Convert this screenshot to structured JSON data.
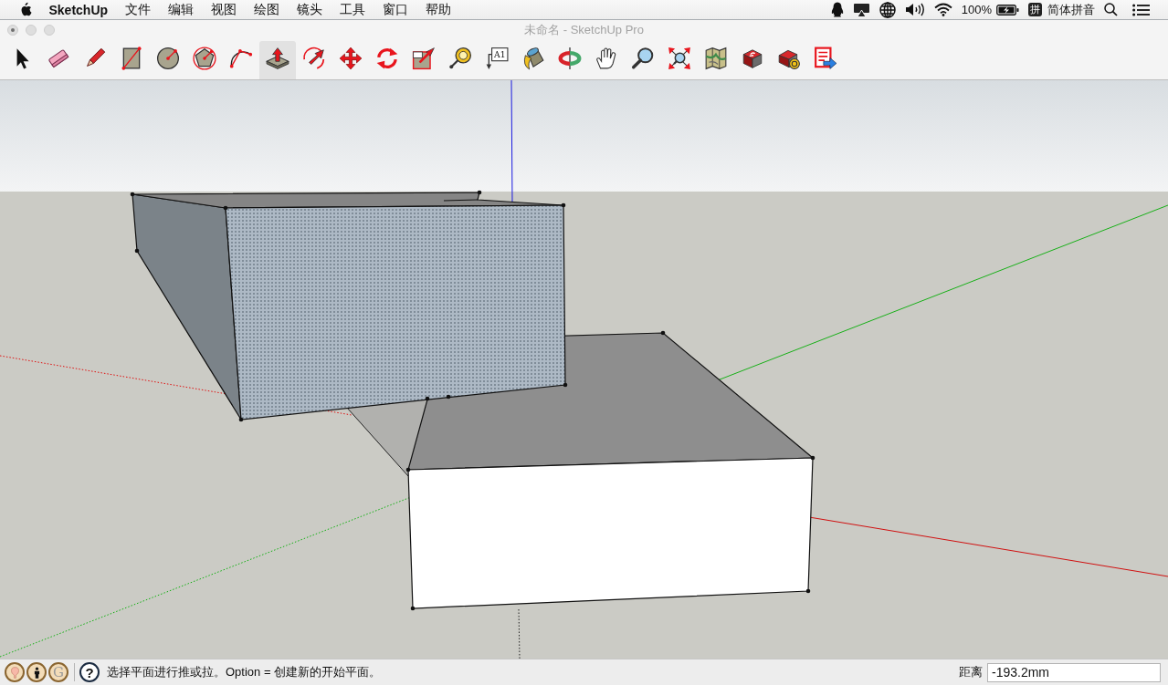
{
  "menu_bar": {
    "app_name": "SketchUp",
    "menus": [
      "文件",
      "编辑",
      "视图",
      "绘图",
      "镜头",
      "工具",
      "窗口",
      "帮助"
    ],
    "battery_percent": "100%",
    "input_method_badge": "拼",
    "input_method": "简体拼音"
  },
  "window": {
    "title": "未命名 - SketchUp Pro"
  },
  "toolbar": {
    "tools": [
      {
        "kind": "select",
        "selected": false
      },
      {
        "kind": "eraser",
        "selected": false
      },
      {
        "kind": "pencil",
        "selected": false
      },
      {
        "kind": "rectangle",
        "selected": false
      },
      {
        "kind": "circle",
        "selected": false
      },
      {
        "kind": "polygon",
        "selected": false
      },
      {
        "kind": "arc",
        "selected": false
      },
      {
        "kind": "pushpull",
        "selected": true
      },
      {
        "kind": "followme",
        "selected": false
      },
      {
        "kind": "move",
        "selected": false
      },
      {
        "kind": "rotate",
        "selected": false
      },
      {
        "kind": "scale",
        "selected": false
      },
      {
        "kind": "tape",
        "selected": false
      },
      {
        "kind": "text",
        "selected": false,
        "label": "A1"
      },
      {
        "kind": "paint",
        "selected": false
      },
      {
        "kind": "orbit",
        "selected": false
      },
      {
        "kind": "pan",
        "selected": false
      },
      {
        "kind": "zoom",
        "selected": false
      },
      {
        "kind": "extents",
        "selected": false
      },
      {
        "kind": "map",
        "selected": false
      },
      {
        "kind": "warehouse",
        "selected": false
      },
      {
        "kind": "extension",
        "selected": false
      },
      {
        "kind": "share",
        "selected": false
      }
    ]
  },
  "status_bar": {
    "account_letter": "G",
    "help": "?",
    "hint": "选择平面进行推或拉。Option = 创建新的开始平面。",
    "measurement": {
      "label": "距离",
      "value": "-193.2mm"
    }
  }
}
